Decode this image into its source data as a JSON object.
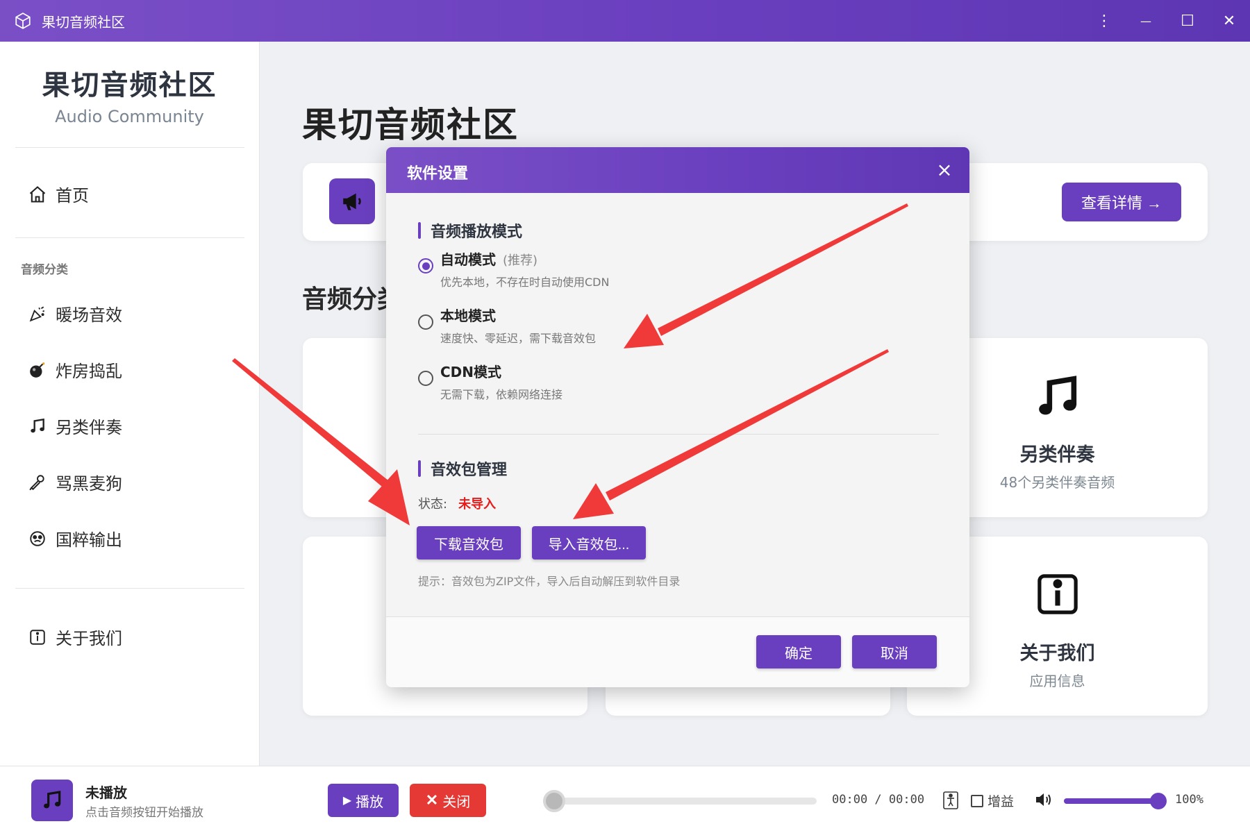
{
  "window": {
    "title": "果切音频社区",
    "controls": {
      "menu": "⋮",
      "minimize": "—",
      "maximize": "☐",
      "close": "✕"
    }
  },
  "sidebar": {
    "brand_title": "果切音频社区",
    "brand_subtitle": "Audio Community",
    "home": "首页",
    "group_label": "音频分类",
    "items": [
      {
        "label": "暖场音效",
        "icon": "party-popper-icon"
      },
      {
        "label": "炸房捣乱",
        "icon": "bomb-icon"
      },
      {
        "label": "另类伴奏",
        "icon": "music-note-icon"
      },
      {
        "label": "骂黑麦狗",
        "icon": "microphone-icon"
      },
      {
        "label": "国粹输出",
        "icon": "mask-icon"
      }
    ],
    "about": "关于我们"
  },
  "main": {
    "title": "果切音频社区",
    "banner_button": "查看详情 →",
    "section_title": "音频分类",
    "cards": [
      {
        "title": "另类伴奏",
        "subtitle": "48个另类伴奏音频",
        "icon": "music-note-icon"
      },
      {
        "title": "关于我们",
        "subtitle": "应用信息",
        "icon": "info-icon"
      }
    ]
  },
  "dialog": {
    "title": "软件设置",
    "playback_section": "音频播放模式",
    "modes": [
      {
        "label": "自动模式",
        "tag": "(推荐)",
        "desc": "优先本地，不存在时自动使用CDN",
        "selected": true
      },
      {
        "label": "本地模式",
        "tag": "",
        "desc": "速度快、零延迟，需下载音效包",
        "selected": false
      },
      {
        "label": "CDN模式",
        "tag": "",
        "desc": "无需下载，依赖网络连接",
        "selected": false
      }
    ],
    "pack_section": "音效包管理",
    "status_label": "状态:",
    "status_value": "未导入",
    "download_button": "下载音效包",
    "import_button": "导入音效包...",
    "hint": "提示：音效包为ZIP文件，导入后自动解压到软件目录",
    "ok_button": "确定",
    "cancel_button": "取消"
  },
  "player": {
    "title": "未播放",
    "subtitle": "点击音频按钮开始播放",
    "play_button": "播放",
    "close_button": "关闭",
    "time": "00:00 / 00:00",
    "gain_label": "增益",
    "volume": "100%",
    "volume_level": 1.0,
    "progress": 0.0
  },
  "colors": {
    "accent": "#6a3fbf",
    "danger": "#e53935",
    "status_red": "#e51c1c",
    "annotation_arrow": "#f03a3a"
  }
}
